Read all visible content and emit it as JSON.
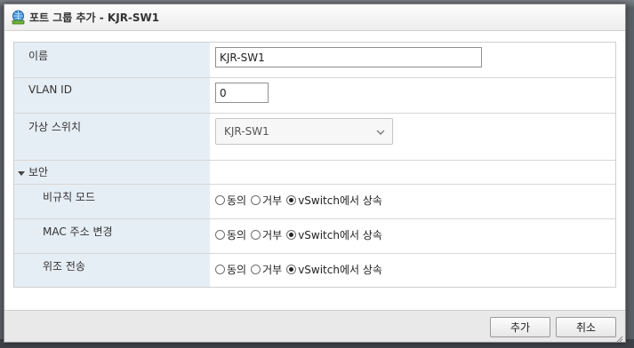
{
  "dialog": {
    "title": "포트 그룹 추가 - KJR-SW1"
  },
  "form": {
    "name_label": "이름",
    "name_value": "KJR-SW1",
    "vlan_label": "VLAN ID",
    "vlan_value": "0",
    "vswitch_label": "가상 스위치",
    "vswitch_value": "KJR-SW1",
    "security_label": "보안",
    "security_rows": [
      {
        "label": "비규칙 모드",
        "options": [
          "동의",
          "거부",
          "vSwitch에서 상속"
        ],
        "selected": "vSwitch에서 상속"
      },
      {
        "label": "MAC 주소 변경",
        "options": [
          "동의",
          "거부",
          "vSwitch에서 상속"
        ],
        "selected": "vSwitch에서 상속"
      },
      {
        "label": "위조 전송",
        "options": [
          "동의",
          "거부",
          "vSwitch에서 상속"
        ],
        "selected": "vSwitch에서 상속"
      }
    ]
  },
  "footer": {
    "add_label": "추가",
    "cancel_label": "취소"
  },
  "icons": {
    "title": "network-portgroup-icon",
    "toggle": "triangle-down-icon",
    "dropdown": "chevron-down-icon",
    "grip": "resize-grip-icon"
  }
}
